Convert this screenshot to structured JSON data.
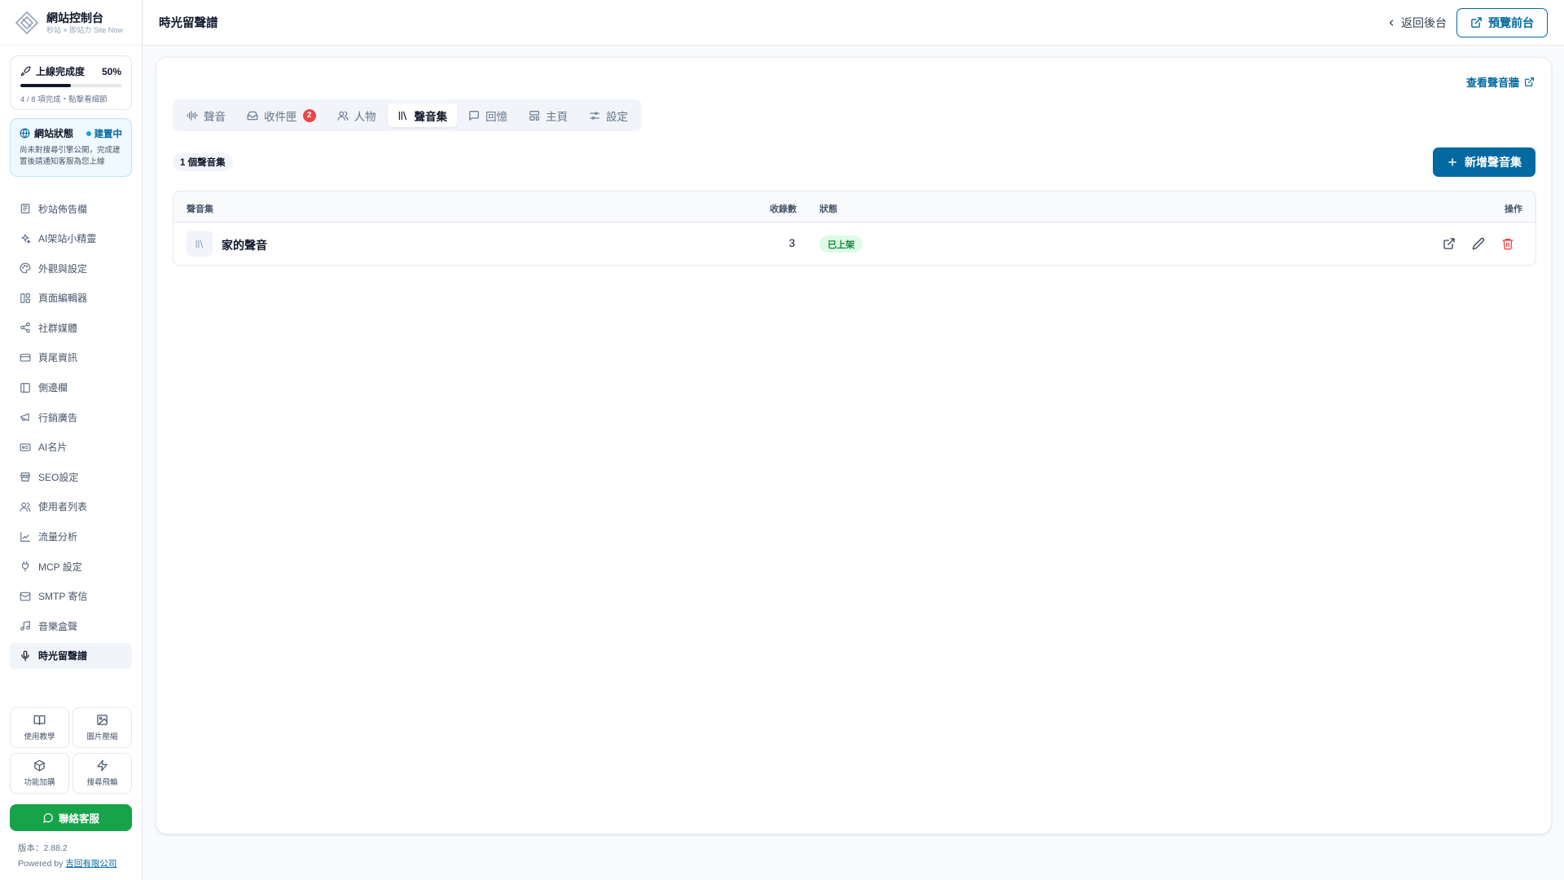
{
  "brand": {
    "title": "網站控制台",
    "subtitle": "秒站 × 即站力 Site Now"
  },
  "progress": {
    "label": "上線完成度",
    "percent_text": "50%",
    "fraction": 0.5,
    "note": "4 / 8 項完成・點擊看細節"
  },
  "site_status": {
    "label": "網站狀態",
    "badge": "建置中",
    "note": "尚未對搜尋引擎公開，完成建置後請通知客服為您上線"
  },
  "nav": [
    {
      "label": "秒站佈告欄",
      "icon": "newspaper-icon"
    },
    {
      "label": "AI架站小精靈",
      "icon": "sparkles-icon"
    },
    {
      "label": "外觀與設定",
      "icon": "palette-icon"
    },
    {
      "label": "頁面編輯器",
      "icon": "layout-icon"
    },
    {
      "label": "社群媒體",
      "icon": "share-icon"
    },
    {
      "label": "頁尾資訊",
      "icon": "credit-card-icon"
    },
    {
      "label": "側邊欄",
      "icon": "sidebar-icon"
    },
    {
      "label": "行銷廣告",
      "icon": "megaphone-icon"
    },
    {
      "label": "AI名片",
      "icon": "id-card-icon"
    },
    {
      "label": "SEO設定",
      "icon": "store-icon"
    },
    {
      "label": "使用者列表",
      "icon": "users-icon"
    },
    {
      "label": "流量分析",
      "icon": "line-chart-icon"
    },
    {
      "label": "MCP 設定",
      "icon": "plug-icon"
    },
    {
      "label": "SMTP 寄信",
      "icon": "mail-icon"
    },
    {
      "label": "音樂盒聲",
      "icon": "music-icon"
    },
    {
      "label": "時光留聲譜",
      "icon": "mic-icon",
      "active": true
    }
  ],
  "tiles": [
    {
      "label": "使用教學",
      "icon": "book-icon"
    },
    {
      "label": "圖片壓縮",
      "icon": "image-icon"
    },
    {
      "label": "功能加購",
      "icon": "package-icon"
    },
    {
      "label": "搜尋飛輪",
      "icon": "zap-icon"
    }
  ],
  "support_label": "聯絡客服",
  "version": "版本：2.88.2",
  "powered_prefix": "Powered by ",
  "powered_company": "吉回有限公司",
  "header": {
    "title": "時光留聲譜",
    "back_label": "返回後台",
    "preview_label": "預覽前台"
  },
  "main": {
    "wall_link": "查看聲音牆",
    "tabs": [
      {
        "label": "聲音",
        "icon": "audio-lines-icon"
      },
      {
        "label": "收件匣",
        "icon": "inbox-icon",
        "badge": "2"
      },
      {
        "label": "人物",
        "icon": "users-icon"
      },
      {
        "label": "聲音集",
        "icon": "library-icon",
        "active": true
      },
      {
        "label": "回憶",
        "icon": "message-square-icon"
      },
      {
        "label": "主頁",
        "icon": "layout-template-icon"
      },
      {
        "label": "設定",
        "icon": "sliders-icon"
      }
    ],
    "count_label": "1 個聲音集",
    "add_label": "新增聲音集",
    "table": {
      "headers": {
        "collection": "聲音集",
        "count": "收錄數",
        "status": "狀態",
        "actions": "操作"
      },
      "rows": [
        {
          "name": "家的聲音",
          "count": "3",
          "status": "已上架"
        }
      ]
    }
  },
  "colors": {
    "accent": "#0369a1",
    "success": "#16a34a",
    "danger": "#ef4444",
    "status_bg": "#dcfce7"
  }
}
